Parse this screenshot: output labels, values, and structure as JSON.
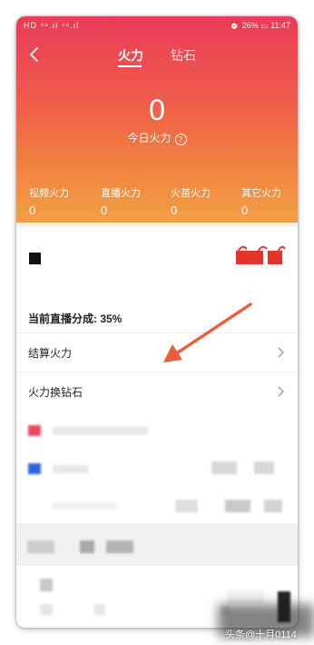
{
  "status_bar": {
    "left": "HD ⁴⁶.ıl ⁴⁶.ıl",
    "right": "⏰ 26% ▭ 11:47"
  },
  "tabs": [
    {
      "label": "火力",
      "active": true
    },
    {
      "label": "钻石",
      "active": false
    }
  ],
  "summary": {
    "value": "0",
    "label": "今日火力"
  },
  "stats": [
    {
      "label": "视频火力",
      "value": "0"
    },
    {
      "label": "直播火力",
      "value": "0"
    },
    {
      "label": "火苗火力",
      "value": "0"
    },
    {
      "label": "其它火力",
      "value": "0"
    }
  ],
  "share": {
    "label": "当前直播分成: 35%"
  },
  "menu": [
    {
      "label": "结算火力"
    },
    {
      "label": "火力换钻石"
    }
  ],
  "watermark": "头条@十月0114",
  "colors": {
    "header_top": "#ea3b58",
    "header_bottom": "#f2a046",
    "arrow": "#e8603a",
    "badge_red": "#e4352c"
  }
}
